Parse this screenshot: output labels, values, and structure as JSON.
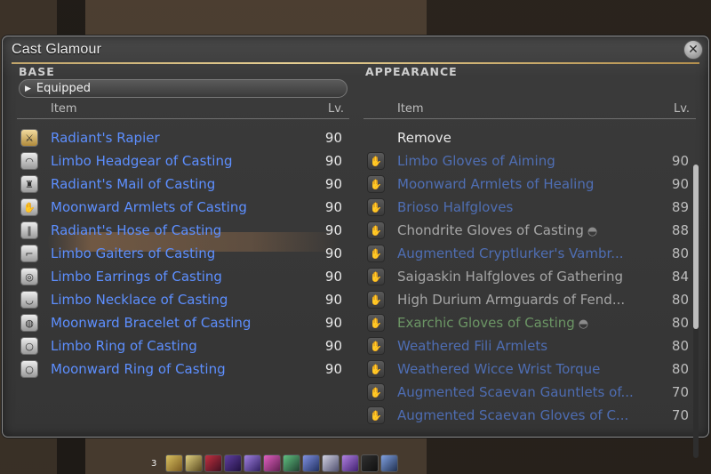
{
  "window": {
    "title": "Cast Glamour",
    "close_glyph": "✕"
  },
  "base": {
    "section": "BASE",
    "dropdown_label": "Equipped",
    "columns": {
      "item": "Item",
      "lv": "Lv."
    },
    "items": [
      {
        "name": "Radiant's Rapier",
        "lv": "90",
        "icon": "rapier-icon"
      },
      {
        "name": "Limbo Headgear of Casting",
        "lv": "90",
        "icon": "headgear-icon"
      },
      {
        "name": "Radiant's Mail of Casting",
        "lv": "90",
        "icon": "body-armor-icon"
      },
      {
        "name": "Moonward Armlets of Casting",
        "lv": "90",
        "icon": "gloves-icon"
      },
      {
        "name": "Radiant's Hose of Casting",
        "lv": "90",
        "icon": "legs-icon"
      },
      {
        "name": "Limbo Gaiters of Casting",
        "lv": "90",
        "icon": "feet-icon"
      },
      {
        "name": "Limbo Earrings of Casting",
        "lv": "90",
        "icon": "earrings-icon"
      },
      {
        "name": "Limbo Necklace of Casting",
        "lv": "90",
        "icon": "necklace-icon"
      },
      {
        "name": "Moonward Bracelet of Casting",
        "lv": "90",
        "icon": "bracelet-icon"
      },
      {
        "name": "Limbo Ring of Casting",
        "lv": "90",
        "icon": "ring-icon"
      },
      {
        "name": "Moonward Ring of Casting",
        "lv": "90",
        "icon": "ring-icon"
      }
    ]
  },
  "appearance": {
    "section": "APPEARANCE",
    "columns": {
      "item": "Item",
      "lv": "Lv."
    },
    "remove_label": "Remove",
    "items": [
      {
        "name": "Limbo Gloves of Aiming",
        "lv": "90",
        "color": "blue"
      },
      {
        "name": "Moonward Armlets of Healing",
        "lv": "90",
        "color": "blue"
      },
      {
        "name": "Brioso Halfgloves",
        "lv": "89",
        "color": "blue"
      },
      {
        "name": "Chondrite Gloves of Casting",
        "lv": "88",
        "color": "white",
        "mark": "◓"
      },
      {
        "name": "Augmented Cryptlurker's Vambr...",
        "lv": "80",
        "color": "blue"
      },
      {
        "name": "Saigaskin Halfgloves of Gathering",
        "lv": "84",
        "color": "white"
      },
      {
        "name": "High Durium Armguards of Fend...",
        "lv": "80",
        "color": "white"
      },
      {
        "name": "Exarchic Gloves of Casting",
        "lv": "80",
        "color": "green",
        "mark": "◓"
      },
      {
        "name": "Weathered Fili Armlets",
        "lv": "80",
        "color": "blue"
      },
      {
        "name": "Weathered Wicce Wrist Torque",
        "lv": "80",
        "color": "blue"
      },
      {
        "name": "Augmented Scaevan Gauntlets of...",
        "lv": "70",
        "color": "blue"
      },
      {
        "name": "Augmented Scaevan Gloves of C...",
        "lv": "70",
        "color": "blue"
      }
    ]
  },
  "hotbar": {
    "number": "3"
  },
  "colors": {
    "rarity_blue": "#5d8fff",
    "rarity_green": "#8ccf81",
    "header_gold": "#e6cf93"
  }
}
